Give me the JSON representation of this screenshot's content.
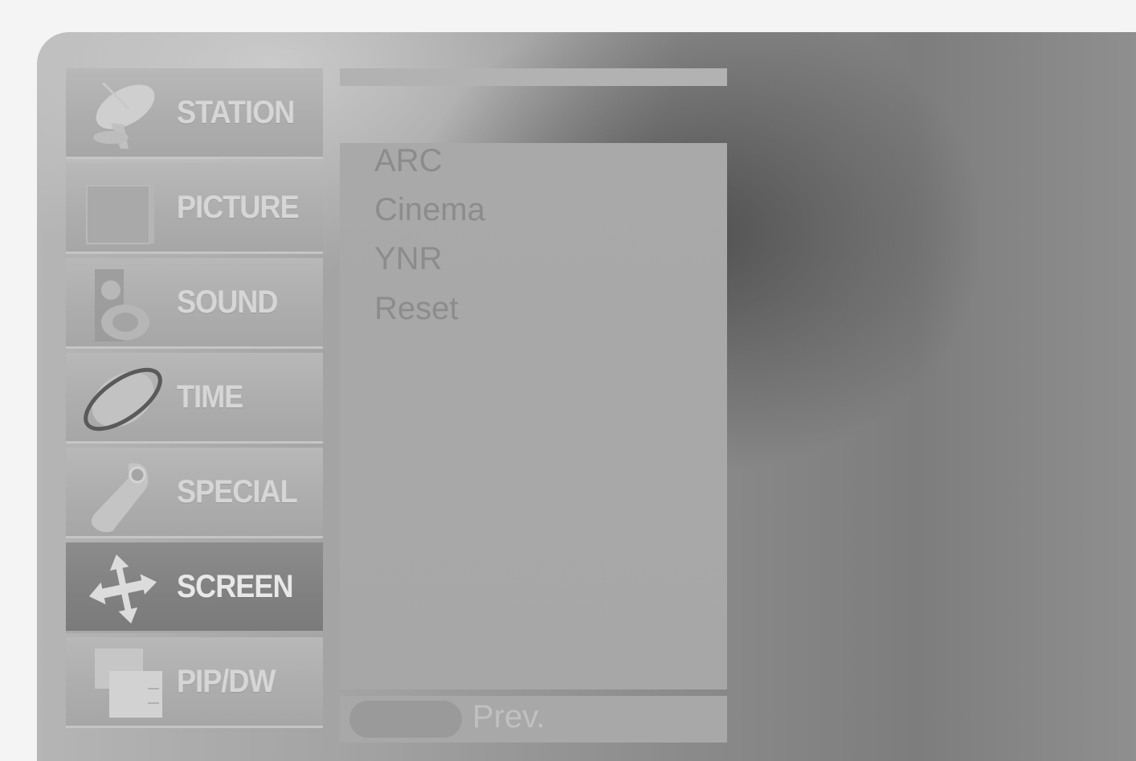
{
  "menu": {
    "items": [
      {
        "label": "STATION",
        "icon": "satellite-dish-icon",
        "active": false
      },
      {
        "label": "PICTURE",
        "icon": "picture-icon",
        "active": false
      },
      {
        "label": "SOUND",
        "icon": "speaker-icon",
        "active": false
      },
      {
        "label": "TIME",
        "icon": "globe-orbit-icon",
        "active": false
      },
      {
        "label": "SPECIAL",
        "icon": "tag-icon",
        "active": false
      },
      {
        "label": "SCREEN",
        "icon": "four-way-arrows-icon",
        "active": true
      },
      {
        "label": "PIP/DW",
        "icon": "overlapping-windows-icon",
        "active": false
      }
    ]
  },
  "submenu": {
    "items": [
      "ARC",
      "Cinema",
      "YNR",
      "Reset"
    ]
  },
  "footer": {
    "prev_label": "Prev."
  }
}
